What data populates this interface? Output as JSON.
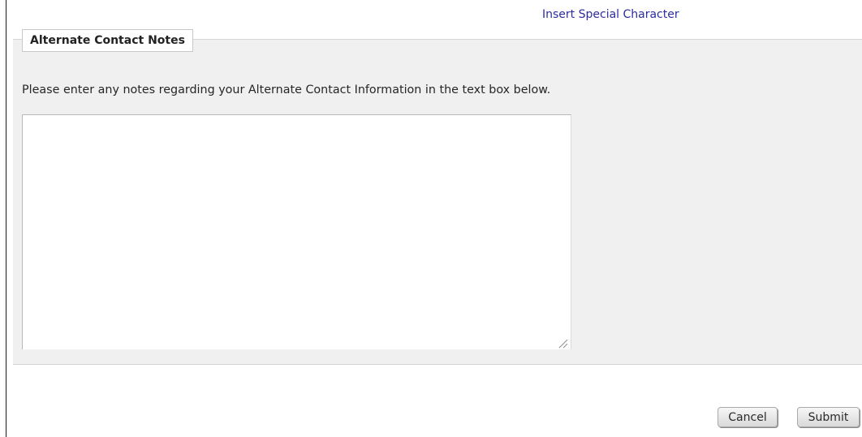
{
  "toolbar": {
    "special_character_link": "Insert Special Character"
  },
  "section": {
    "legend": "Alternate Contact Notes",
    "instructions": "Please enter any notes regarding your Alternate Contact Information in the text box below.",
    "notes_value": "",
    "resize_icon": "resize-grip-icon"
  },
  "buttons": {
    "cancel_label": "Cancel",
    "submit_label": "Submit"
  },
  "colors": {
    "link": "#2c2c9e",
    "panel_background": "#f0f0f0"
  }
}
